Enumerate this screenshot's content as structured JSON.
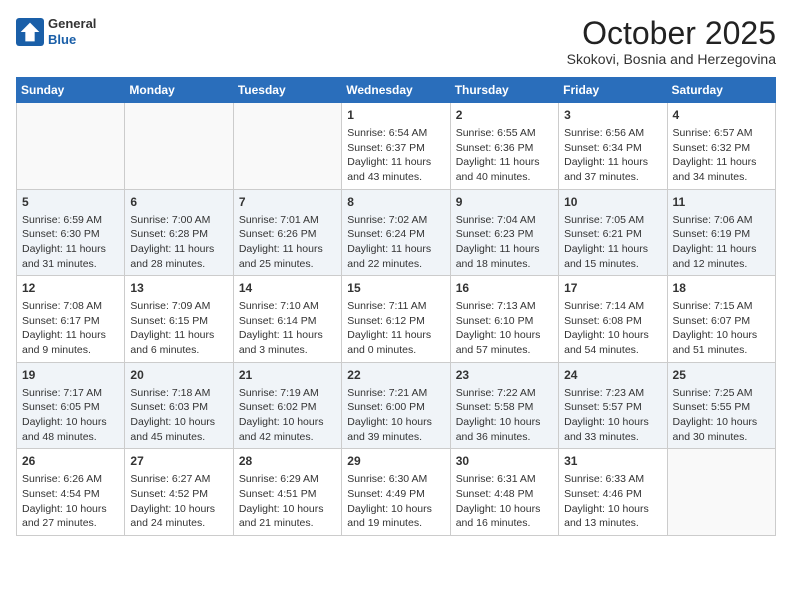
{
  "header": {
    "logo": {
      "general": "General",
      "blue": "Blue"
    },
    "title": "October 2025",
    "subtitle": "Skokovi, Bosnia and Herzegovina"
  },
  "days_of_week": [
    "Sunday",
    "Monday",
    "Tuesday",
    "Wednesday",
    "Thursday",
    "Friday",
    "Saturday"
  ],
  "weeks": [
    [
      {
        "day": "",
        "content": ""
      },
      {
        "day": "",
        "content": ""
      },
      {
        "day": "",
        "content": ""
      },
      {
        "day": "1",
        "content": "Sunrise: 6:54 AM\nSunset: 6:37 PM\nDaylight: 11 hours\nand 43 minutes."
      },
      {
        "day": "2",
        "content": "Sunrise: 6:55 AM\nSunset: 6:36 PM\nDaylight: 11 hours\nand 40 minutes."
      },
      {
        "day": "3",
        "content": "Sunrise: 6:56 AM\nSunset: 6:34 PM\nDaylight: 11 hours\nand 37 minutes."
      },
      {
        "day": "4",
        "content": "Sunrise: 6:57 AM\nSunset: 6:32 PM\nDaylight: 11 hours\nand 34 minutes."
      }
    ],
    [
      {
        "day": "5",
        "content": "Sunrise: 6:59 AM\nSunset: 6:30 PM\nDaylight: 11 hours\nand 31 minutes."
      },
      {
        "day": "6",
        "content": "Sunrise: 7:00 AM\nSunset: 6:28 PM\nDaylight: 11 hours\nand 28 minutes."
      },
      {
        "day": "7",
        "content": "Sunrise: 7:01 AM\nSunset: 6:26 PM\nDaylight: 11 hours\nand 25 minutes."
      },
      {
        "day": "8",
        "content": "Sunrise: 7:02 AM\nSunset: 6:24 PM\nDaylight: 11 hours\nand 22 minutes."
      },
      {
        "day": "9",
        "content": "Sunrise: 7:04 AM\nSunset: 6:23 PM\nDaylight: 11 hours\nand 18 minutes."
      },
      {
        "day": "10",
        "content": "Sunrise: 7:05 AM\nSunset: 6:21 PM\nDaylight: 11 hours\nand 15 minutes."
      },
      {
        "day": "11",
        "content": "Sunrise: 7:06 AM\nSunset: 6:19 PM\nDaylight: 11 hours\nand 12 minutes."
      }
    ],
    [
      {
        "day": "12",
        "content": "Sunrise: 7:08 AM\nSunset: 6:17 PM\nDaylight: 11 hours\nand 9 minutes."
      },
      {
        "day": "13",
        "content": "Sunrise: 7:09 AM\nSunset: 6:15 PM\nDaylight: 11 hours\nand 6 minutes."
      },
      {
        "day": "14",
        "content": "Sunrise: 7:10 AM\nSunset: 6:14 PM\nDaylight: 11 hours\nand 3 minutes."
      },
      {
        "day": "15",
        "content": "Sunrise: 7:11 AM\nSunset: 6:12 PM\nDaylight: 11 hours\nand 0 minutes."
      },
      {
        "day": "16",
        "content": "Sunrise: 7:13 AM\nSunset: 6:10 PM\nDaylight: 10 hours\nand 57 minutes."
      },
      {
        "day": "17",
        "content": "Sunrise: 7:14 AM\nSunset: 6:08 PM\nDaylight: 10 hours\nand 54 minutes."
      },
      {
        "day": "18",
        "content": "Sunrise: 7:15 AM\nSunset: 6:07 PM\nDaylight: 10 hours\nand 51 minutes."
      }
    ],
    [
      {
        "day": "19",
        "content": "Sunrise: 7:17 AM\nSunset: 6:05 PM\nDaylight: 10 hours\nand 48 minutes."
      },
      {
        "day": "20",
        "content": "Sunrise: 7:18 AM\nSunset: 6:03 PM\nDaylight: 10 hours\nand 45 minutes."
      },
      {
        "day": "21",
        "content": "Sunrise: 7:19 AM\nSunset: 6:02 PM\nDaylight: 10 hours\nand 42 minutes."
      },
      {
        "day": "22",
        "content": "Sunrise: 7:21 AM\nSunset: 6:00 PM\nDaylight: 10 hours\nand 39 minutes."
      },
      {
        "day": "23",
        "content": "Sunrise: 7:22 AM\nSunset: 5:58 PM\nDaylight: 10 hours\nand 36 minutes."
      },
      {
        "day": "24",
        "content": "Sunrise: 7:23 AM\nSunset: 5:57 PM\nDaylight: 10 hours\nand 33 minutes."
      },
      {
        "day": "25",
        "content": "Sunrise: 7:25 AM\nSunset: 5:55 PM\nDaylight: 10 hours\nand 30 minutes."
      }
    ],
    [
      {
        "day": "26",
        "content": "Sunrise: 6:26 AM\nSunset: 4:54 PM\nDaylight: 10 hours\nand 27 minutes."
      },
      {
        "day": "27",
        "content": "Sunrise: 6:27 AM\nSunset: 4:52 PM\nDaylight: 10 hours\nand 24 minutes."
      },
      {
        "day": "28",
        "content": "Sunrise: 6:29 AM\nSunset: 4:51 PM\nDaylight: 10 hours\nand 21 minutes."
      },
      {
        "day": "29",
        "content": "Sunrise: 6:30 AM\nSunset: 4:49 PM\nDaylight: 10 hours\nand 19 minutes."
      },
      {
        "day": "30",
        "content": "Sunrise: 6:31 AM\nSunset: 4:48 PM\nDaylight: 10 hours\nand 16 minutes."
      },
      {
        "day": "31",
        "content": "Sunrise: 6:33 AM\nSunset: 4:46 PM\nDaylight: 10 hours\nand 13 minutes."
      },
      {
        "day": "",
        "content": ""
      }
    ]
  ],
  "row_styles": [
    "row-white",
    "row-shaded",
    "row-white",
    "row-shaded",
    "row-white"
  ]
}
